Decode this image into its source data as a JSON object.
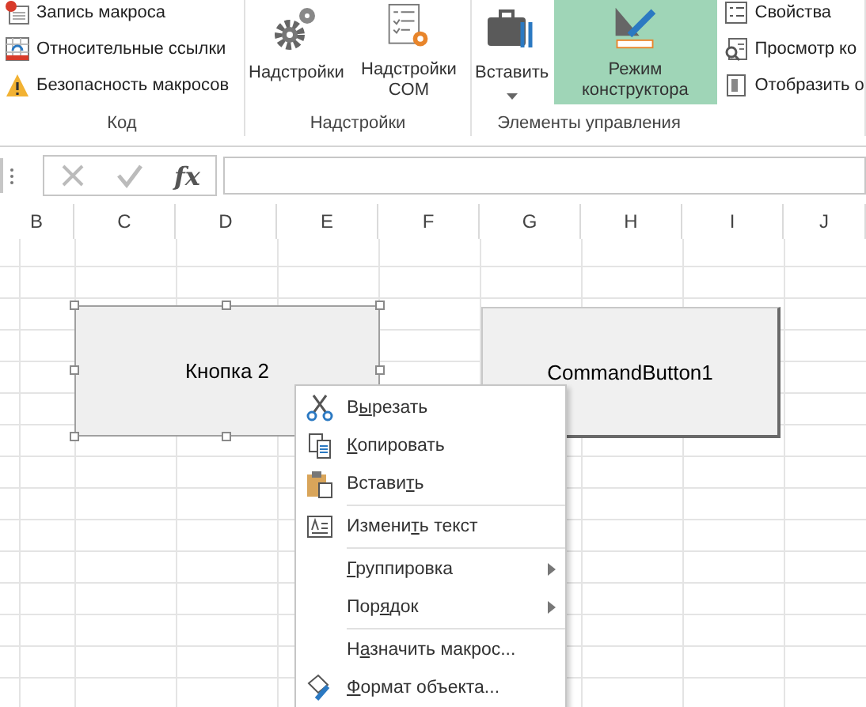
{
  "ribbon": {
    "groups": [
      {
        "kind": "list",
        "label": "Код",
        "items": [
          {
            "label": "Запись макроса",
            "kind": "record"
          },
          {
            "label": "Относительные ссылки",
            "kind": "relative"
          },
          {
            "label": "Безопасность макросов",
            "kind": "warning"
          }
        ]
      },
      {
        "kind": "large",
        "label": "Надстройки",
        "items": [
          {
            "label": "Надстройки",
            "kind": "gears",
            "selected": false,
            "dropdown": false
          },
          {
            "label": "Надстройки COM",
            "kind": "com",
            "selected": false,
            "dropdown": false
          }
        ]
      },
      {
        "kind": "mixed",
        "label": "Элементы управления",
        "items": [
          {
            "label": "Вставить",
            "kind": "toolbox",
            "selected": false,
            "dropdown": true
          },
          {
            "label": "Режим конструктора",
            "kind": "design",
            "selected": true,
            "dropdown": false
          }
        ],
        "small_items": [
          {
            "label": "Свойства",
            "kind": "props"
          },
          {
            "label": "Просмотр ко",
            "kind": "viewcode"
          },
          {
            "label": "Отобразить о",
            "kind": "dialog"
          }
        ]
      }
    ]
  },
  "formula_bar": {
    "function_label": "fx"
  },
  "columns": [
    "B",
    "C",
    "D",
    "E",
    "F",
    "G",
    "H",
    "I",
    "J"
  ],
  "sheet": {
    "form_button": {
      "label": "Кнопка 2",
      "selected": true
    },
    "activex_button": {
      "label": "CommandButton1"
    }
  },
  "context_menu": [
    {
      "kind": "cut",
      "label": {
        "before": "В",
        "key": "ы",
        "after": "резать"
      },
      "submenu": false
    },
    {
      "kind": "copy",
      "label": {
        "key": "К",
        "after": "опировать"
      },
      "submenu": false
    },
    {
      "kind": "paste",
      "label": {
        "before": "Встави",
        "key": "т",
        "after": "ь"
      },
      "submenu": false
    },
    {
      "kind": "separator"
    },
    {
      "kind": "edittext",
      "label": {
        "before": "Измени",
        "key": "т",
        "after": "ь текст"
      },
      "submenu": false
    },
    {
      "kind": "separator"
    },
    {
      "kind": "plain",
      "label": {
        "key": "Г",
        "after": "руппировка"
      },
      "submenu": true
    },
    {
      "kind": "plain",
      "label": {
        "before": "Пор",
        "key": "я",
        "after": "док"
      },
      "submenu": true
    },
    {
      "kind": "separator"
    },
    {
      "kind": "plain",
      "label": {
        "before": "Н",
        "key": "а",
        "after": "значить макрос..."
      },
      "submenu": false
    },
    {
      "kind": "format",
      "label": {
        "key": "Ф",
        "after": "ормат объекта..."
      },
      "submenu": false
    }
  ]
}
